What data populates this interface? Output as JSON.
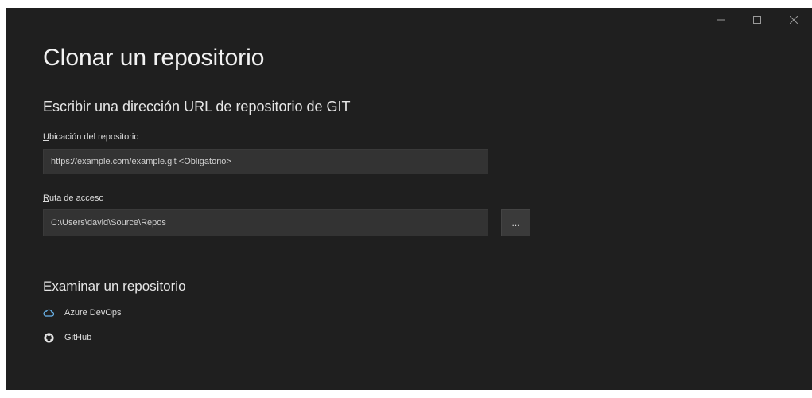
{
  "window": {
    "controls": {
      "minimize_icon": "minimize-icon",
      "maximize_icon": "maximize-icon",
      "close_icon": "close-icon"
    }
  },
  "page": {
    "title": "Clonar un repositorio",
    "subtitle": "Escribir una dirección URL de repositorio de GIT"
  },
  "repo_location": {
    "label_access_key": "U",
    "label_rest": "bicación del repositorio",
    "placeholder": "https://example.com/example.git <Obligatorio>"
  },
  "path": {
    "label_access_key": "R",
    "label_rest": "uta de acceso",
    "value": "C:\\Users\\david\\Source\\Repos",
    "browse_label": "..."
  },
  "browse_section": {
    "title": "Examinar un repositorio",
    "services": [
      {
        "label": "Azure DevOps",
        "icon": "cloud-icon"
      },
      {
        "label": "GitHub",
        "icon": "github-icon"
      }
    ]
  },
  "colors": {
    "background": "#1f1f1f",
    "input_background": "#333333",
    "text": "#e6e6e6"
  }
}
